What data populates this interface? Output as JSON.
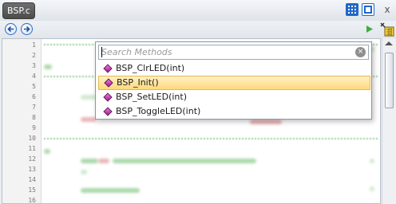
{
  "window": {
    "tab_title": "BSP.c"
  },
  "toolbar": {
    "grid_icon": "grid-icon",
    "view_icon": "view-icon",
    "close_icon": "x"
  },
  "navigation": {
    "back_icon": "back-arrow-icon",
    "forward_icon": "forward-arrow-icon",
    "run_icon": "play-icon",
    "tools_icon": "tools-icon"
  },
  "editor": {
    "line_numbers": [
      "1",
      "2",
      "3",
      "4",
      "5",
      "6",
      "7",
      "8",
      "9",
      "10",
      "11",
      "12",
      "13",
      "14",
      "15",
      "16"
    ]
  },
  "method_popup": {
    "search_placeholder": "Search Methods",
    "search_value": "",
    "clear_icon": "×",
    "items": [
      {
        "label": "BSP_ClrLED(int)",
        "selected": false
      },
      {
        "label": "BSP_Init()",
        "selected": true
      },
      {
        "label": "BSP_SetLED(int)",
        "selected": false
      },
      {
        "label": "BSP_ToggleLED(int)",
        "selected": false
      }
    ]
  },
  "colors": {
    "selection": "#ffd97a",
    "method_icon": "#c83fb6",
    "accent": "#1f67c9"
  }
}
